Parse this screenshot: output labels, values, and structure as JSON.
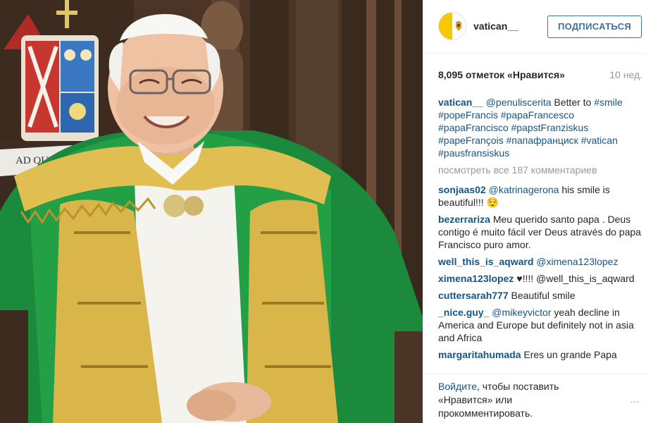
{
  "post": {
    "username": "vatican__",
    "follow_label": "ПОДПИСАТЬСЯ",
    "likes": "8,095 отметок «Нравится»",
    "age": "10 нед."
  },
  "caption": {
    "user": "vatican__",
    "mention": "@penuliscerita",
    "text": "Better to",
    "tags": "#smile #popeFrancis #papaFrancesco #papaFrancisco #papstFranziskus #papeFrançois #папафранциск #vatican #pausfransiskus"
  },
  "view_all": "посмотреть все 187 комментариев",
  "comments": [
    {
      "user": "sonjaas02",
      "mention": "@katrinagerona",
      "text": "his smile is beautiful!!! 😌"
    },
    {
      "user": "bezerrariza",
      "mention": "",
      "text": "Meu querido santo papa . Deus contigo é muito fácil ver Deus através do papa Francisco puro amor."
    },
    {
      "user": "well_this_is_aqward",
      "mention": "@ximena123lopez",
      "text": ""
    },
    {
      "user": "ximena123lopez",
      "mention": "",
      "text": "♥!!!! @well_this_is_aqward"
    },
    {
      "user": "cuttersarah777",
      "mention": "",
      "text": "Beautiful smile"
    },
    {
      "user": "_nice.guy_",
      "mention": "@mikeyvictor",
      "text": "yeah decline in America and Europe but definitely not in asia and Africa"
    },
    {
      "user": "margaritahumada",
      "mention": "",
      "text": "Eres un grande Papa"
    }
  ],
  "footer": {
    "login_link": "Войдите",
    "login_text": ", чтобы поставить «Нравится» или прокомментировать.",
    "more_icon": "…"
  },
  "photo": {
    "motto_text": "AD QUEM"
  }
}
